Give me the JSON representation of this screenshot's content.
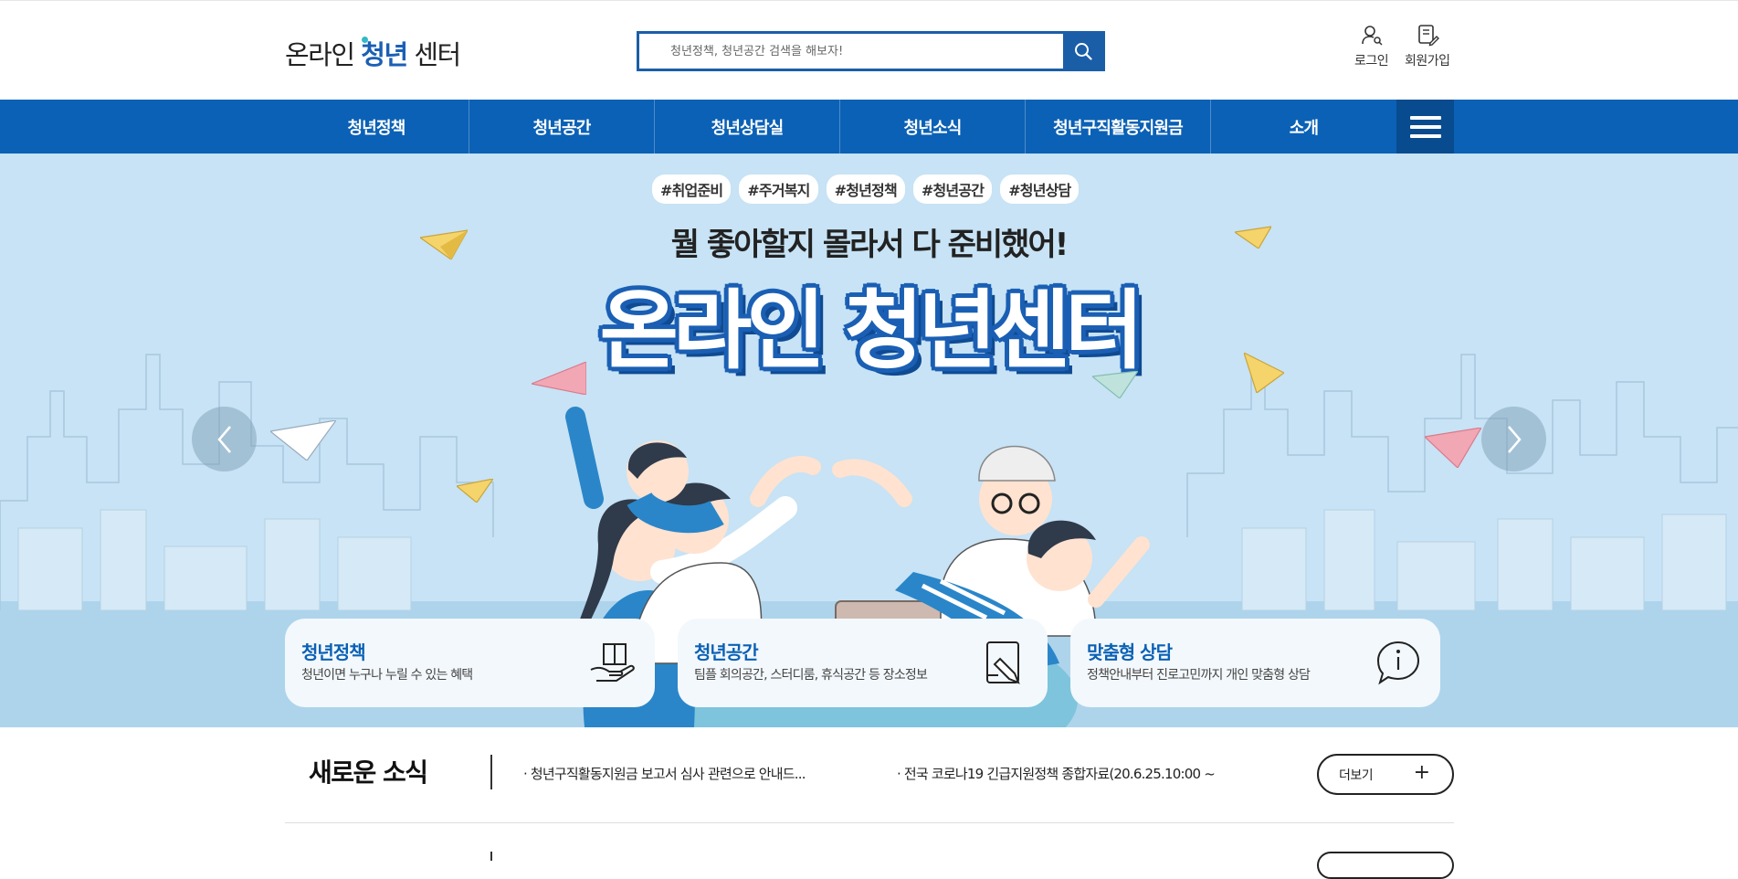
{
  "header": {
    "logo": {
      "part1": "온라인 ",
      "highlight": "청년",
      "part2": " 센터"
    },
    "search_placeholder": "청년정책, 청년공간 검색을 해보자!",
    "login_label": "로그인",
    "join_label": "회원가입"
  },
  "nav": {
    "items": [
      "청년정책",
      "청년공간",
      "청년상담실",
      "청년소식",
      "청년구직활동지원금",
      "소개"
    ]
  },
  "hero": {
    "tags": [
      "#취업준비",
      "#주거복지",
      "#청년정책",
      "#청년공간",
      "#청년상담"
    ],
    "subtitle": "뭘 좋아할지 몰라서 다 준비했어!",
    "title": "온라인 청년센터"
  },
  "cards": [
    {
      "title": "청년정책",
      "desc": "청년이면 누구나 누릴 수 있는 혜택",
      "icon": "hand-book-icon"
    },
    {
      "title": "청년공간",
      "desc": "팀플 회의공간, 스터디룸, 휴식공간 등 장소정보",
      "icon": "pen-board-icon"
    },
    {
      "title": "맞춤형 상담",
      "desc": "정책안내부터 진로고민까지 개인 맞춤형 상담",
      "icon": "info-bubble-icon"
    }
  ],
  "news": {
    "title": "새로운 소식",
    "items": [
      "· 청년구직활동지원금 보고서 심사 관련으로 안내드...",
      "· 전국 코로나19 긴급지원정책 종합자료(20.6.25.10:00 ~"
    ],
    "more_label": "더보기",
    "more_icon": "+"
  },
  "colors": {
    "brand_blue": "#0b61b5",
    "nav_dark": "#084b8f",
    "hero_bg": "#c7e3f5"
  }
}
